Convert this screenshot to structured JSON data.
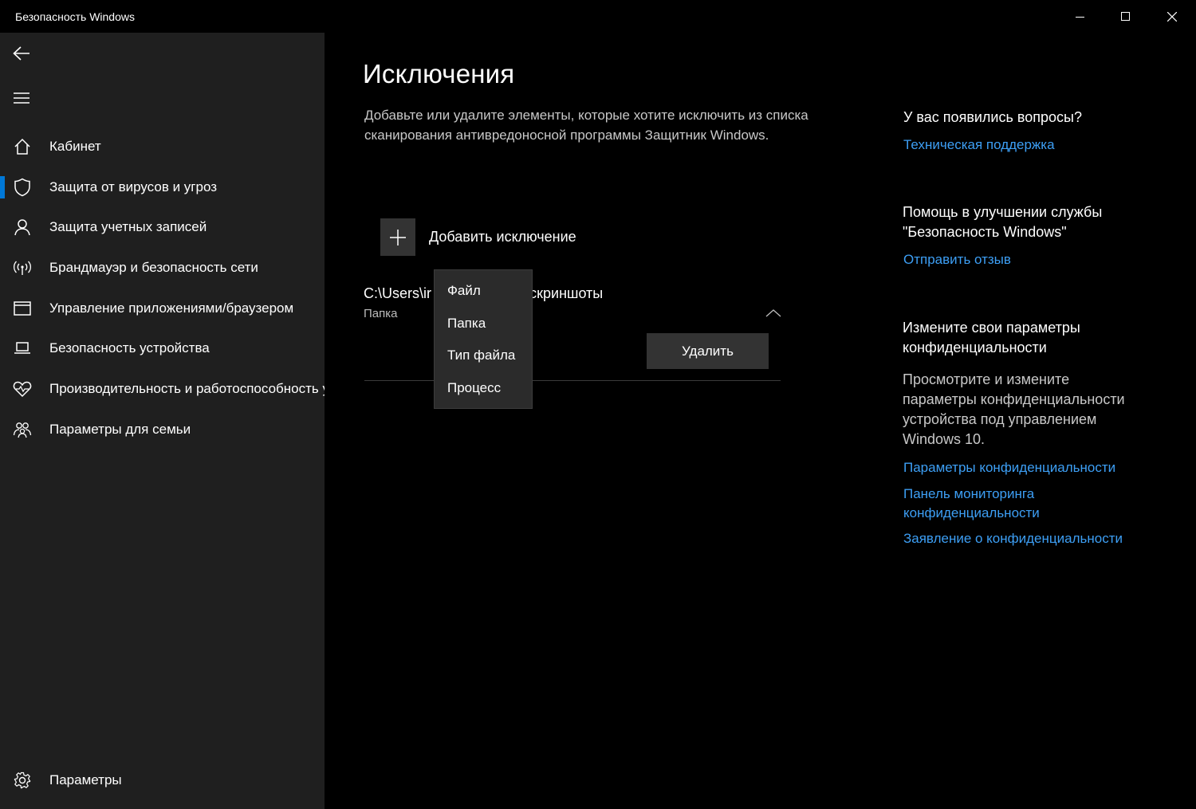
{
  "window": {
    "title": "Безопасность Windows"
  },
  "sidebar": {
    "items": [
      {
        "label": "Кабинет",
        "icon": "home-icon"
      },
      {
        "label": "Защита от вирусов и угроз",
        "icon": "shield-icon",
        "active": true
      },
      {
        "label": "Защита учетных записей",
        "icon": "person-icon"
      },
      {
        "label": "Брандмауэр и безопасность сети",
        "icon": "wireless-icon"
      },
      {
        "label": "Управление приложениями/браузером",
        "icon": "app-window-icon"
      },
      {
        "label": "Безопасность устройства",
        "icon": "laptop-icon"
      },
      {
        "label": "Производительность и работоспособность устройства",
        "icon": "heart-icon"
      },
      {
        "label": "Параметры для семьи",
        "icon": "family-icon"
      }
    ],
    "settings_label": "Параметры"
  },
  "main": {
    "title": "Исключения",
    "description": "Добавьте или удалите элементы, которые хотите исключить из списка сканирования антивредоносной программы Защитник Windows.",
    "add_label": "Добавить исключение",
    "exclusion": {
      "path": "C:\\Users\\ir               Изображения\\скриншоты",
      "type": "Папка"
    },
    "delete_label": "Удалить"
  },
  "flyout": {
    "items": [
      "Файл",
      "Папка",
      "Тип файла",
      "Процесс"
    ]
  },
  "right": {
    "questions_heading": "У вас появились вопросы?",
    "support_link": "Техническая поддержка",
    "improve_heading": "Помощь в улучшении службы \"Безопасность Windows\"",
    "feedback_link": "Отправить отзыв",
    "privacy_heading": "Измените свои параметры конфиденциальности",
    "privacy_text": "Просмотрите и измените параметры конфиденциальности устройства под управлением Windows 10.",
    "privacy_links": [
      "Параметры конфиденциальности",
      "Панель мониторинга конфиденциальности",
      "Заявление о конфиденциальности"
    ]
  },
  "colors": {
    "accent": "#0078d7",
    "link": "#3d9ff5",
    "sidebar_bg": "#1f1f1f",
    "main_bg": "#000000"
  }
}
